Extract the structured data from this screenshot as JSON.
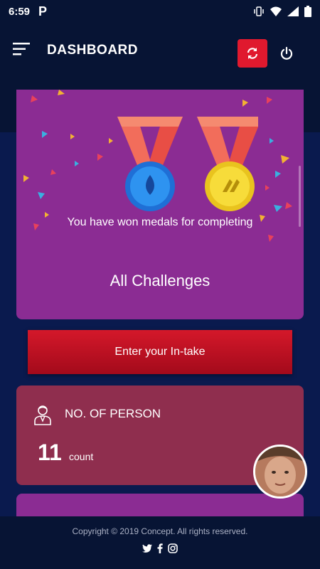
{
  "status_bar": {
    "time": "6:59",
    "notification": "P"
  },
  "app_bar": {
    "title": "DASHBOARD"
  },
  "medal_card": {
    "message": "You have won medals for completing",
    "title": "All Challenges"
  },
  "intake_button": {
    "label": "Enter your In-take"
  },
  "person_card": {
    "title": "NO. OF PERSON",
    "count": "11",
    "unit": "count"
  },
  "footer": {
    "copyright": "Copyright © 2019 Concept. All rights reserved."
  },
  "colors": {
    "primary_dark": "#071434",
    "background": "#0a1a4e",
    "accent_red": "#e0192e",
    "medal_card": "#8b2c93",
    "person_card": "#8f2e4e"
  },
  "icons": [
    "menu-icon",
    "sync-icon",
    "power-icon",
    "person-icon",
    "twitter-icon",
    "facebook-icon",
    "instagram-icon",
    "vibrate-icon",
    "wifi-icon",
    "signal-icon",
    "battery-icon"
  ]
}
